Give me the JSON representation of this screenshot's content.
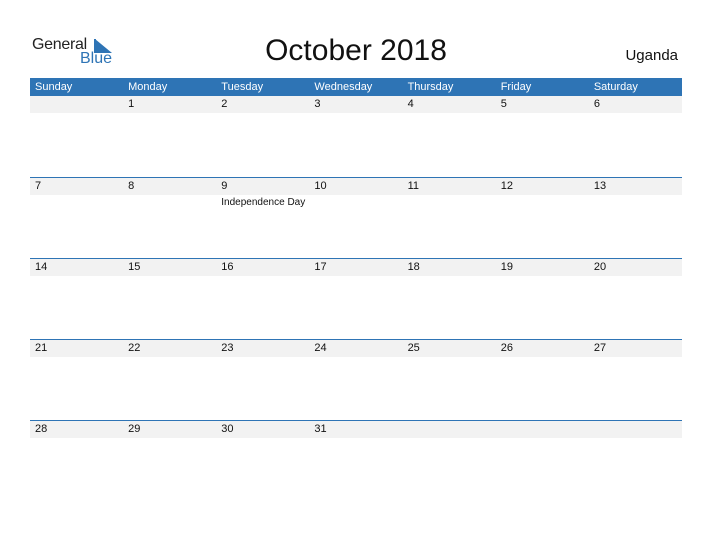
{
  "logo": {
    "line1": "General",
    "line2": "Blue"
  },
  "title": "October 2018",
  "country": "Uganda",
  "colors": {
    "accent": "#2e74b5",
    "day_strip": "#f2f2f2"
  },
  "weekdays": [
    "Sunday",
    "Monday",
    "Tuesday",
    "Wednesday",
    "Thursday",
    "Friday",
    "Saturday"
  ],
  "weeks": [
    {
      "days": [
        "",
        "1",
        "2",
        "3",
        "4",
        "5",
        "6"
      ],
      "events": [
        "",
        "",
        "",
        "",
        "",
        "",
        ""
      ]
    },
    {
      "days": [
        "7",
        "8",
        "9",
        "10",
        "11",
        "12",
        "13"
      ],
      "events": [
        "",
        "",
        "Independence Day",
        "",
        "",
        "",
        ""
      ]
    },
    {
      "days": [
        "14",
        "15",
        "16",
        "17",
        "18",
        "19",
        "20"
      ],
      "events": [
        "",
        "",
        "",
        "",
        "",
        "",
        ""
      ]
    },
    {
      "days": [
        "21",
        "22",
        "23",
        "24",
        "25",
        "26",
        "27"
      ],
      "events": [
        "",
        "",
        "",
        "",
        "",
        "",
        ""
      ]
    },
    {
      "days": [
        "28",
        "29",
        "30",
        "31",
        "",
        "",
        ""
      ],
      "events": [
        "",
        "",
        "",
        "",
        "",
        "",
        ""
      ]
    }
  ]
}
